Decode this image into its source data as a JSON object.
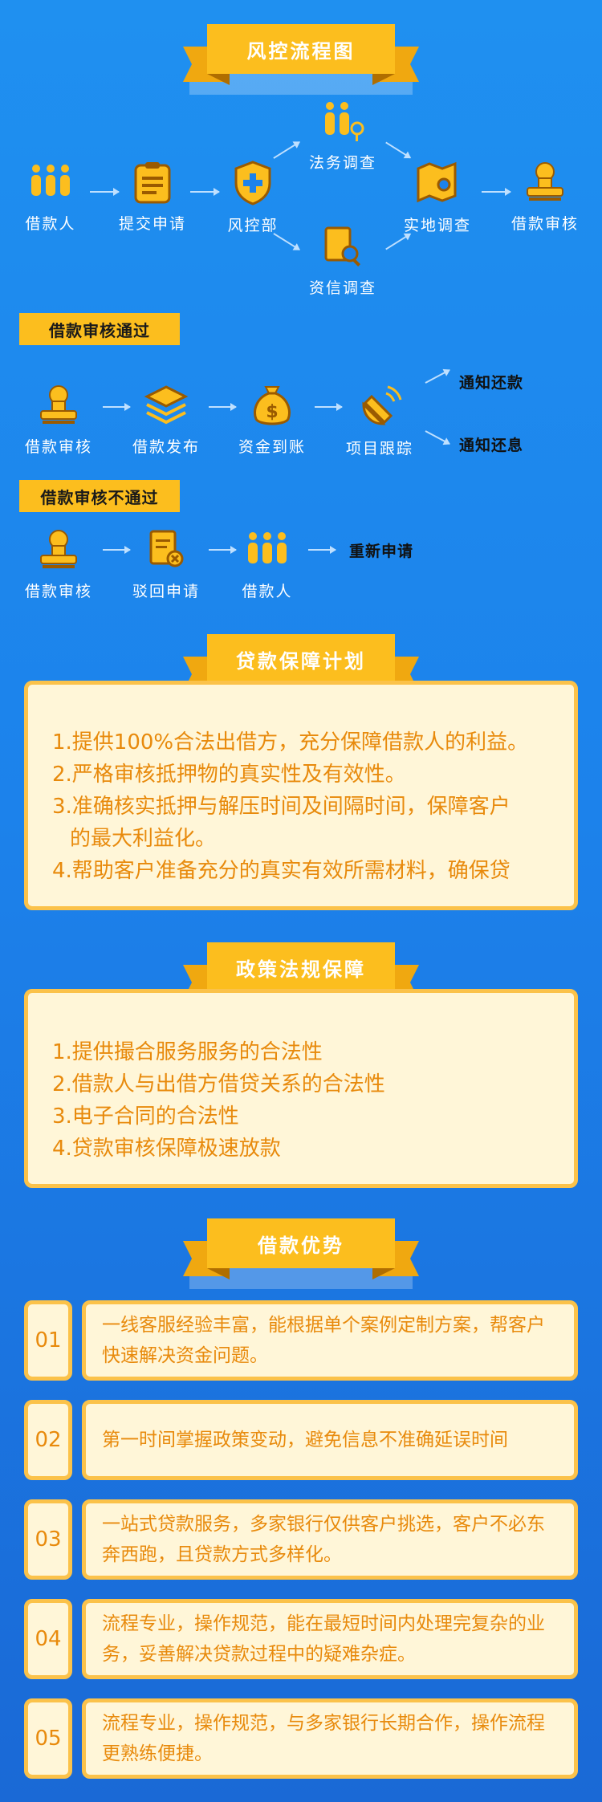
{
  "titles": {
    "flow": "风控流程图",
    "guarantee": "贷款保障计划",
    "policy": "政策法规保障",
    "advantages": "借款优势"
  },
  "flow": {
    "borrower": "借款人",
    "submit": "提交申请",
    "risk_dept": "风控部",
    "legal": "法务调查",
    "credit": "资信调查",
    "field": "实地调查",
    "review": "借款审核"
  },
  "pass": {
    "tag": "借款审核通过",
    "review": "借款审核",
    "publish": "借款发布",
    "funds": "资金到账",
    "tracking": "项目跟踪",
    "notify_repay": "通知还款",
    "notify_interest": "通知还息"
  },
  "fail": {
    "tag": "借款审核不通过",
    "review": "借款审核",
    "reject": "驳回申请",
    "borrower": "借款人",
    "reapply": "重新申请"
  },
  "guarantee_items": [
    "1.提供100%合法出借方，充分保障借款人的利益。",
    "2.严格审核抵押物的真实性及有效性。",
    "3.准确核实抵押与解压时间及间隔时间，保障客户",
    "的最大利益化。",
    "4.帮助客户准备充分的真实有效所需材料，确保贷"
  ],
  "policy_items": [
    "1.提供撮合服务服务的合法性",
    "2.借款人与出借方借贷关系的合法性",
    "3.电子合同的合法性",
    "4.贷款审核保障极速放款"
  ],
  "advantages": [
    {
      "num": "01",
      "text": "一线客服经验丰富，能根据单个案例定制方案，帮客户快速解决资金问题。"
    },
    {
      "num": "02",
      "text": "第一时间掌握政策变动，避免信息不准确延误时间"
    },
    {
      "num": "03",
      "text": "一站式贷款服务，多家银行仅供客户挑选，客户不必东奔西跑，且贷款方式多样化。"
    },
    {
      "num": "04",
      "text": "流程专业，操作规范，能在最短时间内处理完复杂的业务，妥善解决贷款过程中的疑难杂症。"
    },
    {
      "num": "05",
      "text": "流程专业，操作规范，与多家银行长期合作，操作流程更熟练便捷。"
    }
  ],
  "colors": {
    "accent": "#fcbe1e",
    "card_bg": "#fff6d8",
    "card_text": "#e88a0c",
    "bg": "#1c82eb"
  }
}
